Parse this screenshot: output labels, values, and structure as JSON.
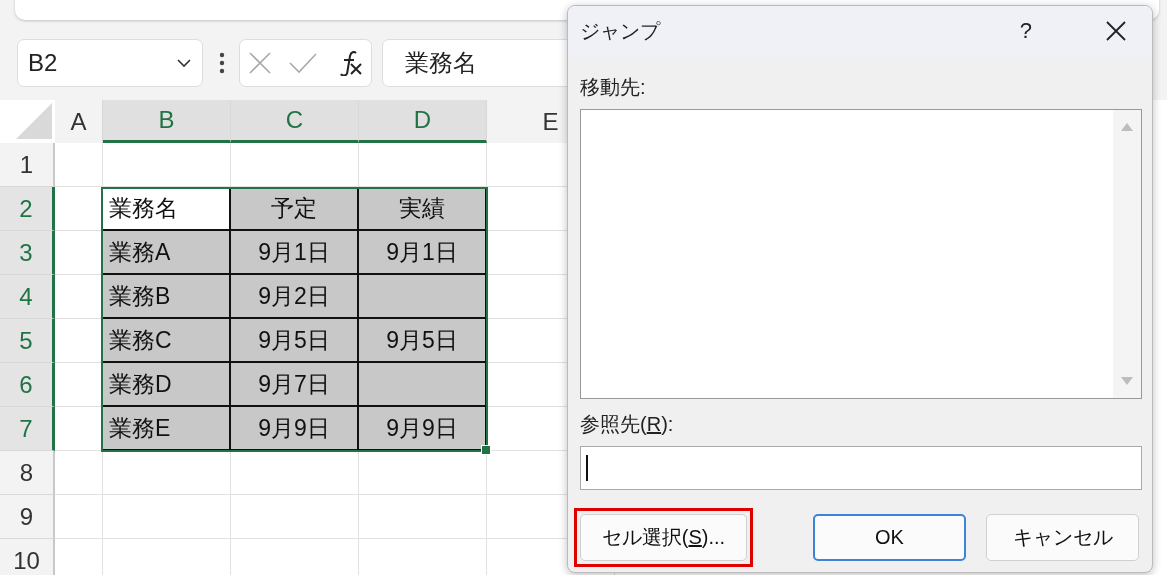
{
  "formula_bar": {
    "name_box": "B2",
    "formula": "業務名"
  },
  "columns": [
    {
      "label": "A",
      "selected": false
    },
    {
      "label": "B",
      "selected": true
    },
    {
      "label": "C",
      "selected": true
    },
    {
      "label": "D",
      "selected": true
    },
    {
      "label": "E",
      "selected": false
    }
  ],
  "rows": [
    {
      "label": "1",
      "selected": false
    },
    {
      "label": "2",
      "selected": true,
      "cells": [
        {
          "text": "業務名",
          "active": true
        },
        {
          "text": "予定",
          "active": false
        },
        {
          "text": "実績",
          "active": false
        }
      ]
    },
    {
      "label": "3",
      "selected": true,
      "cells": [
        {
          "text": "業務A",
          "active": false
        },
        {
          "text": "9月1日",
          "active": false
        },
        {
          "text": "9月1日",
          "active": false
        }
      ]
    },
    {
      "label": "4",
      "selected": true,
      "cells": [
        {
          "text": "業務B",
          "active": false
        },
        {
          "text": "9月2日",
          "active": false
        },
        {
          "active": false
        }
      ]
    },
    {
      "label": "5",
      "selected": true,
      "cells": [
        {
          "text": "業務C",
          "active": false
        },
        {
          "text": "9月5日",
          "active": false
        },
        {
          "text": "9月5日",
          "active": false
        }
      ]
    },
    {
      "label": "6",
      "selected": true,
      "cells": [
        {
          "text": "業務D",
          "active": false
        },
        {
          "text": "9月7日",
          "active": false
        },
        {
          "active": false
        }
      ]
    },
    {
      "label": "7",
      "selected": true,
      "cells": [
        {
          "text": "業務E",
          "active": false
        },
        {
          "text": "9月9日",
          "active": false
        },
        {
          "text": "9月9日",
          "active": false
        }
      ]
    },
    {
      "label": "8",
      "selected": false
    },
    {
      "label": "9",
      "selected": false
    },
    {
      "label": "10",
      "selected": false
    }
  ],
  "dialog": {
    "title": "ジャンプ",
    "help": "?",
    "goto_label": "移動先:",
    "reference_label": [
      "参照先(",
      "R",
      "):"
    ],
    "reference_field": {
      "focused": true
    },
    "buttons": [
      {
        "parts": [
          "セル選択(",
          "S",
          ")..."
        ],
        "default": false,
        "highlighted": true
      },
      {
        "parts": [
          "OK"
        ],
        "default": true,
        "highlighted": false
      },
      {
        "parts": [
          "キャンセル"
        ],
        "default": false,
        "highlighted": false
      }
    ]
  }
}
